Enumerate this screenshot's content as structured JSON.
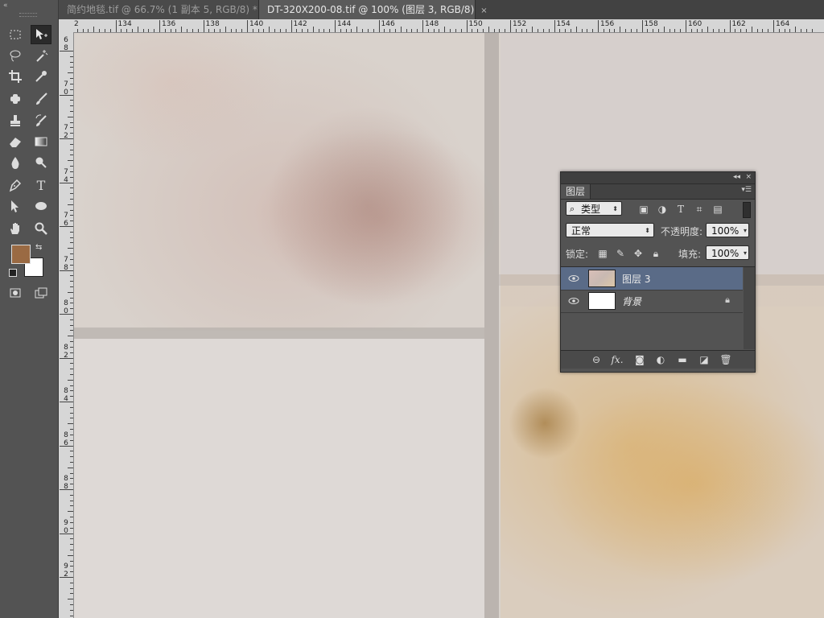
{
  "tabs": [
    {
      "title": "简约地毯.tif @ 66.7% (1 副本 5, RGB/8) *",
      "close": "×"
    },
    {
      "title": "DT-320X200-08.tif @ 100% (图层 3, RGB/8)",
      "close": "×"
    }
  ],
  "ruler_top": {
    "labels": [
      "2",
      "134",
      "136",
      "138",
      "140",
      "142",
      "144",
      "146",
      "148",
      "150",
      "152",
      "154",
      "156",
      "158",
      "160",
      "162",
      "164"
    ]
  },
  "ruler_left": {
    "labels": [
      "6",
      "8",
      "7",
      "0",
      "7",
      "2",
      "7",
      "4",
      "7",
      "6",
      "7",
      "8",
      "8",
      "0",
      "8",
      "2",
      "8",
      "4",
      "8",
      "6",
      "8",
      "8",
      "9",
      "0",
      "9",
      "2"
    ]
  },
  "toolbar": {
    "collapse_icon": "«",
    "colors": {
      "foreground": "#9a6a43",
      "background": "#ffffff"
    },
    "tools": [
      "rectangular-marquee-icon",
      "move-icon",
      "lasso-icon",
      "magic-wand-icon",
      "crop-icon",
      "eyedropper-icon",
      "spot-healing-icon",
      "brush-icon",
      "clone-stamp-icon",
      "history-brush-icon",
      "eraser-icon",
      "gradient-icon",
      "blur-icon",
      "dodge-icon",
      "pen-icon",
      "type-icon",
      "path-selection-icon",
      "ellipse-icon",
      "hand-icon",
      "zoom-icon"
    ],
    "type_tool_label": "T"
  },
  "layers_panel": {
    "collapse_btn": "◂◂",
    "close_btn": "×",
    "tab_label": "图层",
    "filter_label": "类型",
    "blend_mode": "正常",
    "opacity_label": "不透明度:",
    "opacity_value": "100%",
    "lock_label": "锁定:",
    "fill_label": "填充:",
    "fill_value": "100%",
    "layers": [
      {
        "name": "图层 3",
        "selected": true,
        "locked": false
      },
      {
        "name": "背景",
        "selected": false,
        "locked": true
      }
    ],
    "footer_icons": [
      "link-layers-icon",
      "fx-icon",
      "add-mask-icon",
      "adjustment-layer-icon",
      "group-folder-icon",
      "new-layer-icon",
      "trash-icon"
    ],
    "fx_text": "fx."
  }
}
